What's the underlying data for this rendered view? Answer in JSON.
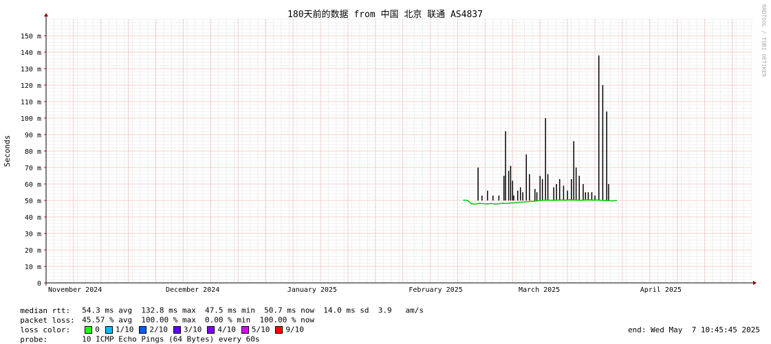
{
  "chart_data": {
    "type": "line",
    "title": "180天前的数据 from 中国 北京 联通 AS4837",
    "ylabel": "Seconds",
    "watermark": "RRDTOOL / TOBI OETIKER",
    "ylim": [
      0,
      160
    ],
    "y_ticks": [
      {
        "v": 0,
        "label": "0"
      },
      {
        "v": 10,
        "label": "10 m"
      },
      {
        "v": 20,
        "label": "20 m"
      },
      {
        "v": 30,
        "label": "30 m"
      },
      {
        "v": 40,
        "label": "40 m"
      },
      {
        "v": 50,
        "label": "50 m"
      },
      {
        "v": 60,
        "label": "60 m"
      },
      {
        "v": 70,
        "label": "70 m"
      },
      {
        "v": 80,
        "label": "80 m"
      },
      {
        "v": 90,
        "label": "90 m"
      },
      {
        "v": 100,
        "label": "100 m"
      },
      {
        "v": 110,
        "label": "110 m"
      },
      {
        "v": 120,
        "label": "120 m"
      },
      {
        "v": 130,
        "label": "130 m"
      },
      {
        "v": 140,
        "label": "140 m"
      },
      {
        "v": 150,
        "label": "150 m"
      }
    ],
    "xlim_days": [
      0,
      180
    ],
    "x_ticks": [
      {
        "d": 0,
        "label": "November 2024"
      },
      {
        "d": 30,
        "label": "December 2024"
      },
      {
        "d": 61,
        "label": "January 2025"
      },
      {
        "d": 92,
        "label": "February 2025"
      },
      {
        "d": 120,
        "label": "March 2025"
      },
      {
        "d": 151,
        "label": "April 2025"
      }
    ],
    "grid": true,
    "series": [
      {
        "color": "#00cc00",
        "x": [
          106.5,
          107.5,
          108.5,
          109.5,
          110.5,
          111.5,
          112.5,
          113.5,
          114.5,
          115.5,
          116.5,
          117.5,
          118.5,
          119.5,
          120.5,
          121.5,
          122.5,
          123.5,
          124.5,
          125.5,
          126.5,
          127.5,
          128.5,
          129.5,
          130.5,
          131.5,
          132.5,
          133.5,
          134.5,
          135.5,
          136.5,
          137.5,
          138.5,
          139.5,
          140.5,
          141.5,
          142.5,
          143.5,
          144.5,
          145.5
        ],
        "y": [
          50.2,
          50.1,
          48.0,
          47.8,
          48.3,
          48.1,
          47.9,
          48.2,
          47.8,
          48.0,
          48.4,
          48.2,
          48.5,
          48.6,
          48.9,
          49.0,
          49.2,
          49.4,
          49.6,
          49.8,
          50.1,
          50.2,
          50.2,
          50.1,
          50.2,
          50.3,
          50.2,
          50.4,
          50.3,
          50.2,
          50.1,
          50.3,
          50.4,
          50.2,
          50.3,
          50.1,
          50.0,
          49.9,
          49.8,
          50.0
        ]
      }
    ],
    "spikes": {
      "color": "#000000",
      "x": [
        110.2,
        111.2,
        112.6,
        114.0,
        115.5,
        116.8,
        117.2,
        118.0,
        118.5,
        119.0,
        119.3,
        120.3,
        121.0,
        121.6,
        122.5,
        123.3,
        124.7,
        125.2,
        126.0,
        126.6,
        127.4,
        128.0,
        129.5,
        130.2,
        131.0,
        132.0,
        133.0,
        134.0,
        134.6,
        135.2,
        136.0,
        137.0,
        137.6,
        138.3,
        139.2,
        140.0,
        141.0,
        142.0,
        143.0,
        143.5
      ],
      "y": [
        70,
        53,
        56,
        53,
        53,
        65,
        92,
        68,
        71,
        62,
        53,
        56,
        58,
        55,
        78,
        66,
        57,
        55,
        65,
        63,
        100,
        66,
        58,
        60,
        63,
        59,
        56,
        63,
        86,
        70,
        65,
        60,
        55,
        55,
        55,
        53,
        138,
        120,
        104,
        60
      ]
    }
  },
  "stats": {
    "median_label": "median rtt:",
    "median_values": "54.3 ms avg  132.8 ms max  47.5 ms min  50.7 ms now  14.0 ms sd  3.9   am/s",
    "loss_label": "packet loss:",
    "loss_values": "45.57 % avg  100.00 % max  0.00 % min  100.00 % now",
    "color_label": "loss color:",
    "loss_colors": [
      {
        "label": "0",
        "color": "#26ff00"
      },
      {
        "label": "1/10",
        "color": "#00b8ff"
      },
      {
        "label": "2/10",
        "color": "#0059ff"
      },
      {
        "label": "3/10",
        "color": "#5e00ff"
      },
      {
        "label": "4/10",
        "color": "#7e00ff"
      },
      {
        "label": "5/10",
        "color": "#dd00ff"
      },
      {
        "label": "9/10",
        "color": "#ff0000"
      }
    ],
    "probe_label": "probe:",
    "probe_value": "10 ICMP Echo Pings (64 Bytes) every 60s",
    "end_text": "end: Wed May  7 10:45:45 2025"
  }
}
